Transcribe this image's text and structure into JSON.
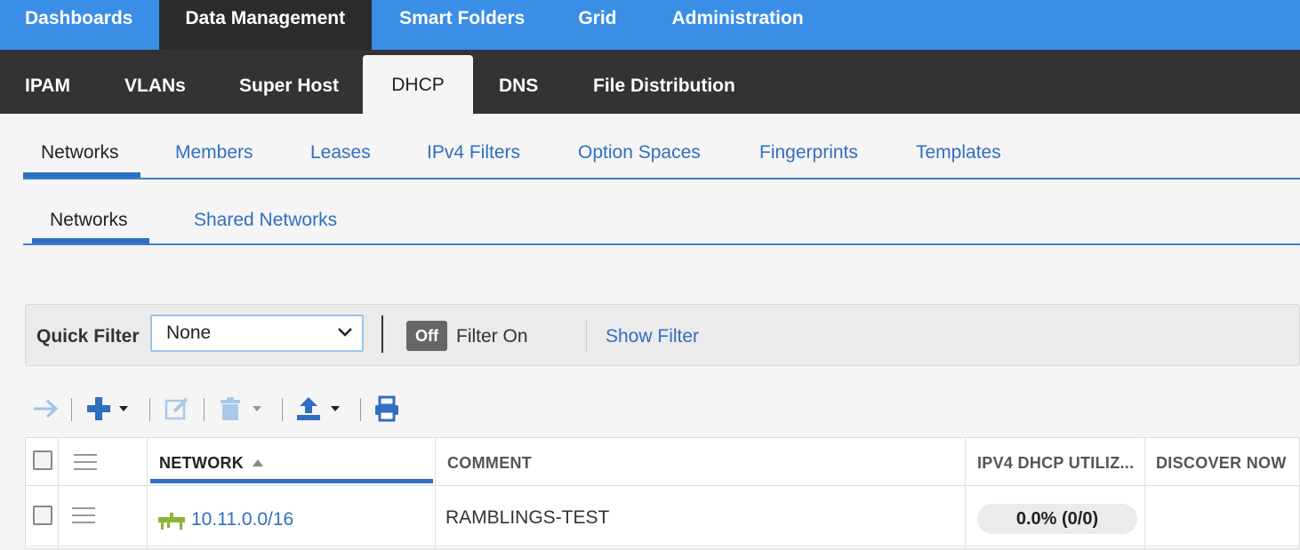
{
  "top_nav": {
    "tabs": [
      {
        "label": "Dashboards"
      },
      {
        "label": "Data Management",
        "active": true
      },
      {
        "label": "Smart Folders"
      },
      {
        "label": "Grid"
      },
      {
        "label": "Administration"
      }
    ]
  },
  "sub_nav": {
    "tabs": [
      {
        "label": "IPAM"
      },
      {
        "label": "VLANs"
      },
      {
        "label": "Super Host"
      },
      {
        "label": "DHCP",
        "active": true
      },
      {
        "label": "DNS"
      },
      {
        "label": "File Distribution"
      }
    ]
  },
  "dhcp_tabs": {
    "tabs": [
      {
        "label": "Networks",
        "active": true
      },
      {
        "label": "Members"
      },
      {
        "label": "Leases"
      },
      {
        "label": "IPv4 Filters"
      },
      {
        "label": "Option Spaces"
      },
      {
        "label": "Fingerprints"
      },
      {
        "label": "Templates"
      }
    ]
  },
  "network_tabs": {
    "tabs": [
      {
        "label": "Networks",
        "active": true
      },
      {
        "label": "Shared Networks"
      }
    ]
  },
  "filter_bar": {
    "quick_filter_label": "Quick Filter",
    "quick_filter_value": "None",
    "toggle_label": "Off",
    "filter_on_label": "Filter On",
    "show_filter_label": "Show Filter"
  },
  "toolbar": {
    "icons": [
      "arrow-right-icon",
      "add-icon",
      "edit-icon",
      "delete-icon",
      "export-icon",
      "print-icon"
    ]
  },
  "grid": {
    "columns": [
      "NETWORK",
      "COMMENT",
      "IPV4 DHCP UTILIZ...",
      "DISCOVER NOW"
    ],
    "sorted_column": "NETWORK",
    "sort_direction": "ascending",
    "rows": [
      {
        "network": "10.11.0.0/16",
        "comment": "RAMBLINGS-TEST",
        "utilization": "0.0% (0/0)",
        "discover_now": ""
      }
    ]
  },
  "colors": {
    "top_nav_bg": "#3a8ee6",
    "sub_nav_bg": "#333333",
    "accent": "#2f6fc1",
    "network_icon": "#8db33a"
  }
}
